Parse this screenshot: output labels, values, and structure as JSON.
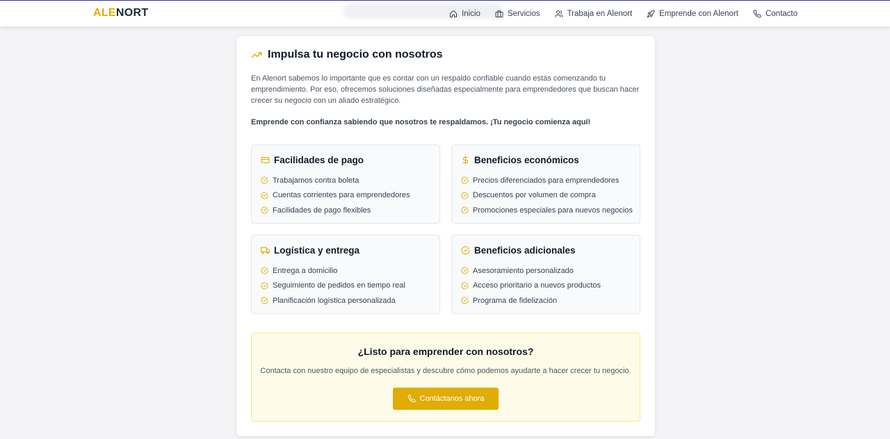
{
  "header": {
    "logo_part1": "ALE",
    "logo_part2": "NORT",
    "nav": [
      {
        "label": "Inicio",
        "icon": "home-icon"
      },
      {
        "label": "Servicios",
        "icon": "briefcase-icon"
      },
      {
        "label": "Trabaja en Alenort",
        "icon": "users-icon"
      },
      {
        "label": "Emprende con Alenort",
        "icon": "rocket-icon"
      },
      {
        "label": "Contacto",
        "icon": "phone-icon"
      }
    ]
  },
  "main": {
    "title": "Impulsa tu negocio con nosotros",
    "title_icon": "trending-up-icon",
    "intro": "En Alenort sabemos lo importante que es contar con un respaldo confiable cuando estás comenzando tu emprendimiento. Por eso, ofrecemos soluciones diseñadas especialmente para emprendedores que buscan hacer crecer su negocio con un aliado estratégico.",
    "tagline": "Emprende con confianza sabiendo que nosotros te respaldamos. ¡Tu negocio comienza aquí!",
    "boxes": [
      {
        "title": "Facilidades de pago",
        "icon": "credit-card-icon",
        "items": [
          "Trabajamos contra boleta",
          "Cuentas corrientes para emprendedores",
          "Facilidades de pago flexibles"
        ]
      },
      {
        "title": "Beneficios económicos",
        "icon": "dollar-icon",
        "items": [
          "Precios diferenciados para emprendedores",
          "Descuentos por volumen de compra",
          "Promociones especiales para nuevos negocios"
        ]
      },
      {
        "title": "Logística y entrega",
        "icon": "truck-icon",
        "items": [
          "Entrega a domicilio",
          "Seguimiento de pedidos en tiempo real",
          "Planificación logística personalizada"
        ]
      },
      {
        "title": "Beneficios adicionales",
        "icon": "check-circle-icon",
        "items": [
          "Asesoramiento personalizado",
          "Acceso prioritario a nuevos productos",
          "Programa de fidelización"
        ]
      }
    ],
    "cta": {
      "title": "¿Listo para emprender con nosotros?",
      "text": "Contacta con nuestro equipo de especialistas y descubre cómo podemos ayudarte a hacer crecer tu negocio.",
      "button": "Contáctanos ahora"
    }
  },
  "colors": {
    "accent": "#e0ac06",
    "cta_background": "#fefce8",
    "page_background": "#f4f4f6"
  }
}
